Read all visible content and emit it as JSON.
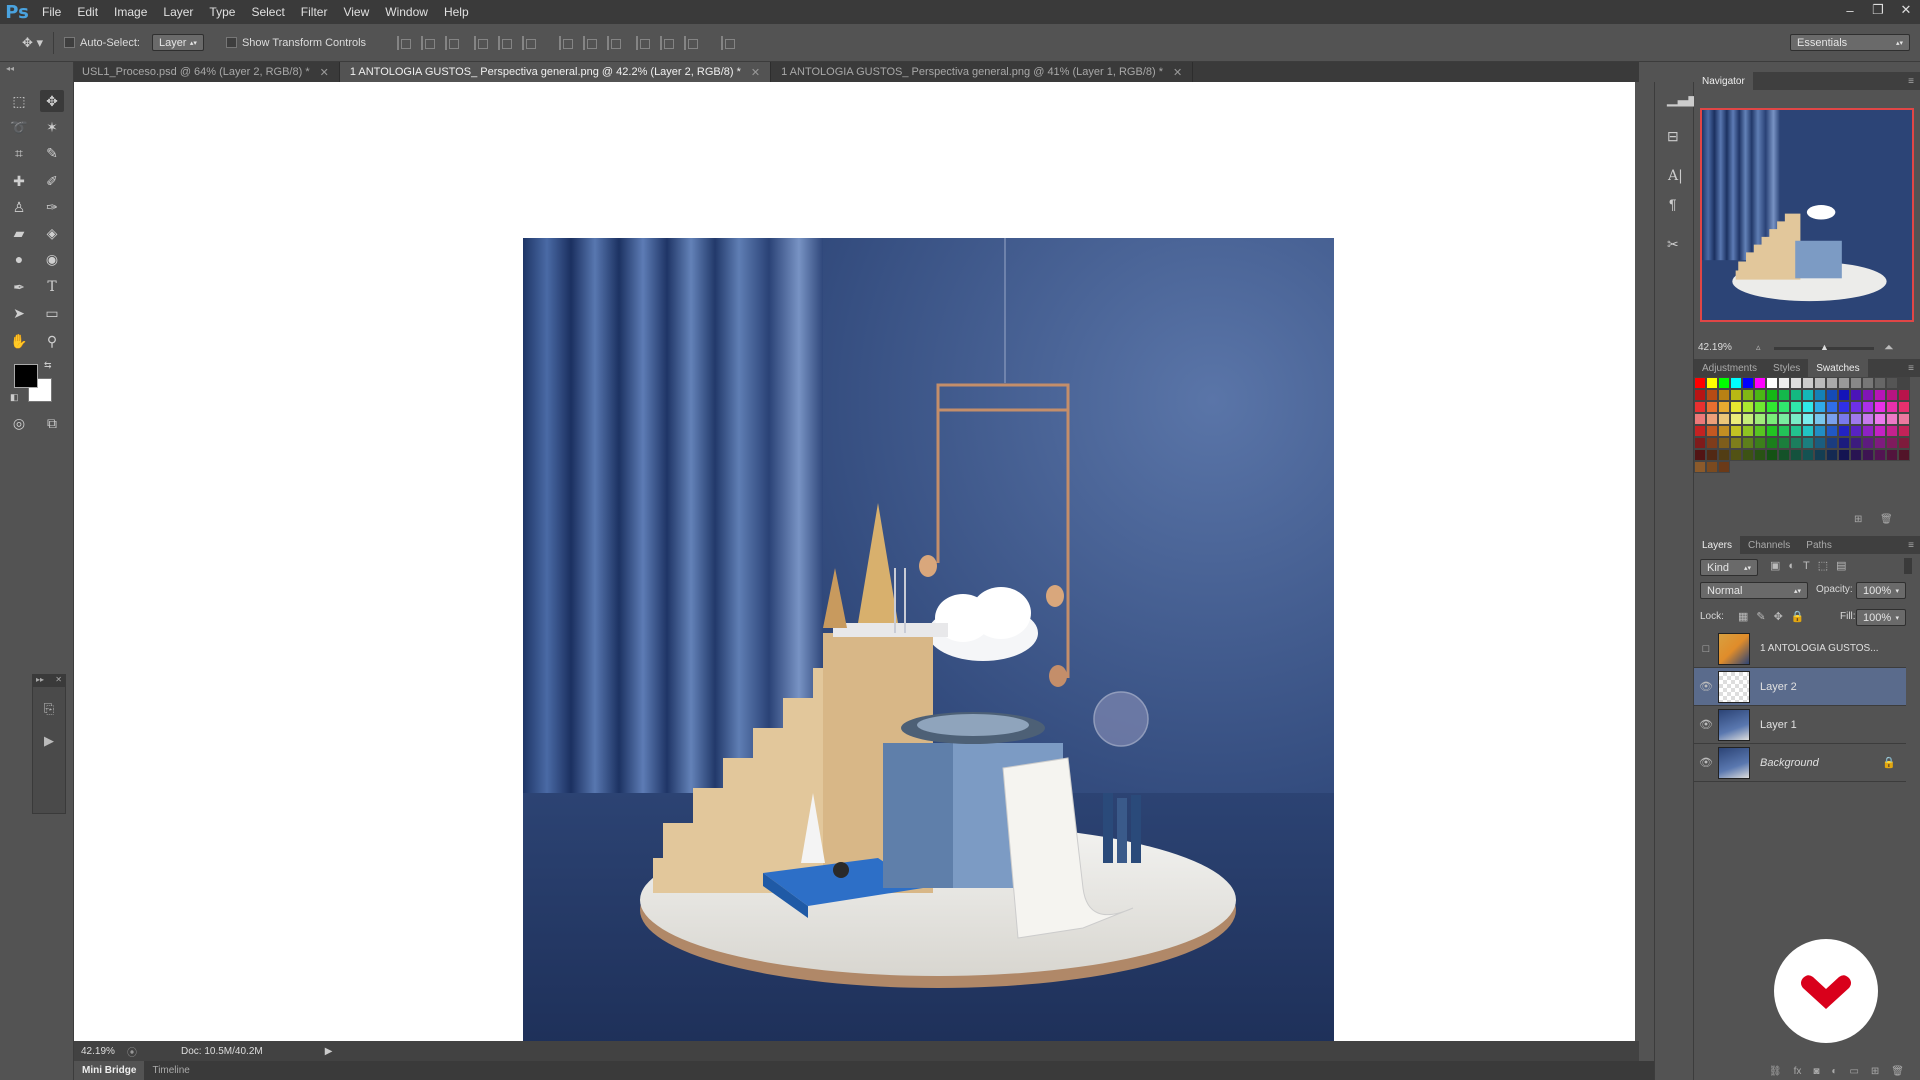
{
  "app": {
    "logo": "Ps",
    "accent": "#4aa3df"
  },
  "menu": [
    "File",
    "Edit",
    "Image",
    "Layer",
    "Type",
    "Select",
    "Filter",
    "View",
    "Window",
    "Help"
  ],
  "window_controls": {
    "minimize": "‒",
    "restore": "❐",
    "close": "✕"
  },
  "options_bar": {
    "auto_select_label": "Auto-Select:",
    "auto_select_value": "Layer",
    "show_transform_label": "Show Transform Controls",
    "workspace": "Essentials"
  },
  "tabs": [
    {
      "label": "USL1_Proceso.psd @ 64% (Layer 2, RGB/8) *",
      "active": false
    },
    {
      "label": "1 ANTOLOGIA GUSTOS_ Perspectiva general.png @ 42.2% (Layer 2, RGB/8) *",
      "active": true
    },
    {
      "label": "1 ANTOLOGIA GUSTOS_ Perspectiva general.png @ 41% (Layer 1, RGB/8) *",
      "active": false
    }
  ],
  "status": {
    "zoom": "42.19%",
    "doc": "Doc: 10.5M/40.2M"
  },
  "bottom_tabs": [
    "Mini Bridge",
    "Timeline"
  ],
  "navigator": {
    "title": "Navigator",
    "zoom": "42.19%"
  },
  "swatch_panel": {
    "tabs": [
      "Adjustments",
      "Styles",
      "Swatches"
    ],
    "active": "Swatches"
  },
  "layers_panel": {
    "tabs": [
      "Layers",
      "Channels",
      "Paths"
    ],
    "kind": "Kind",
    "blend_mode": "Normal",
    "opacity_label": "Opacity:",
    "opacity": "100%",
    "lock_label": "Lock:",
    "fill_label": "Fill:",
    "fill": "100%",
    "layers": [
      {
        "name": "1 ANTOLOGIA GUSTOS...",
        "visible": false,
        "active": false,
        "locked": false
      },
      {
        "name": "Layer 2",
        "visible": true,
        "active": true,
        "locked": false
      },
      {
        "name": "Layer 1",
        "visible": true,
        "active": false,
        "locked": false
      },
      {
        "name": "Background",
        "visible": true,
        "active": false,
        "locked": true
      }
    ]
  },
  "colors": {
    "foreground": "#000000",
    "background": "#ffffff",
    "brand_logo": "#d9001b"
  }
}
